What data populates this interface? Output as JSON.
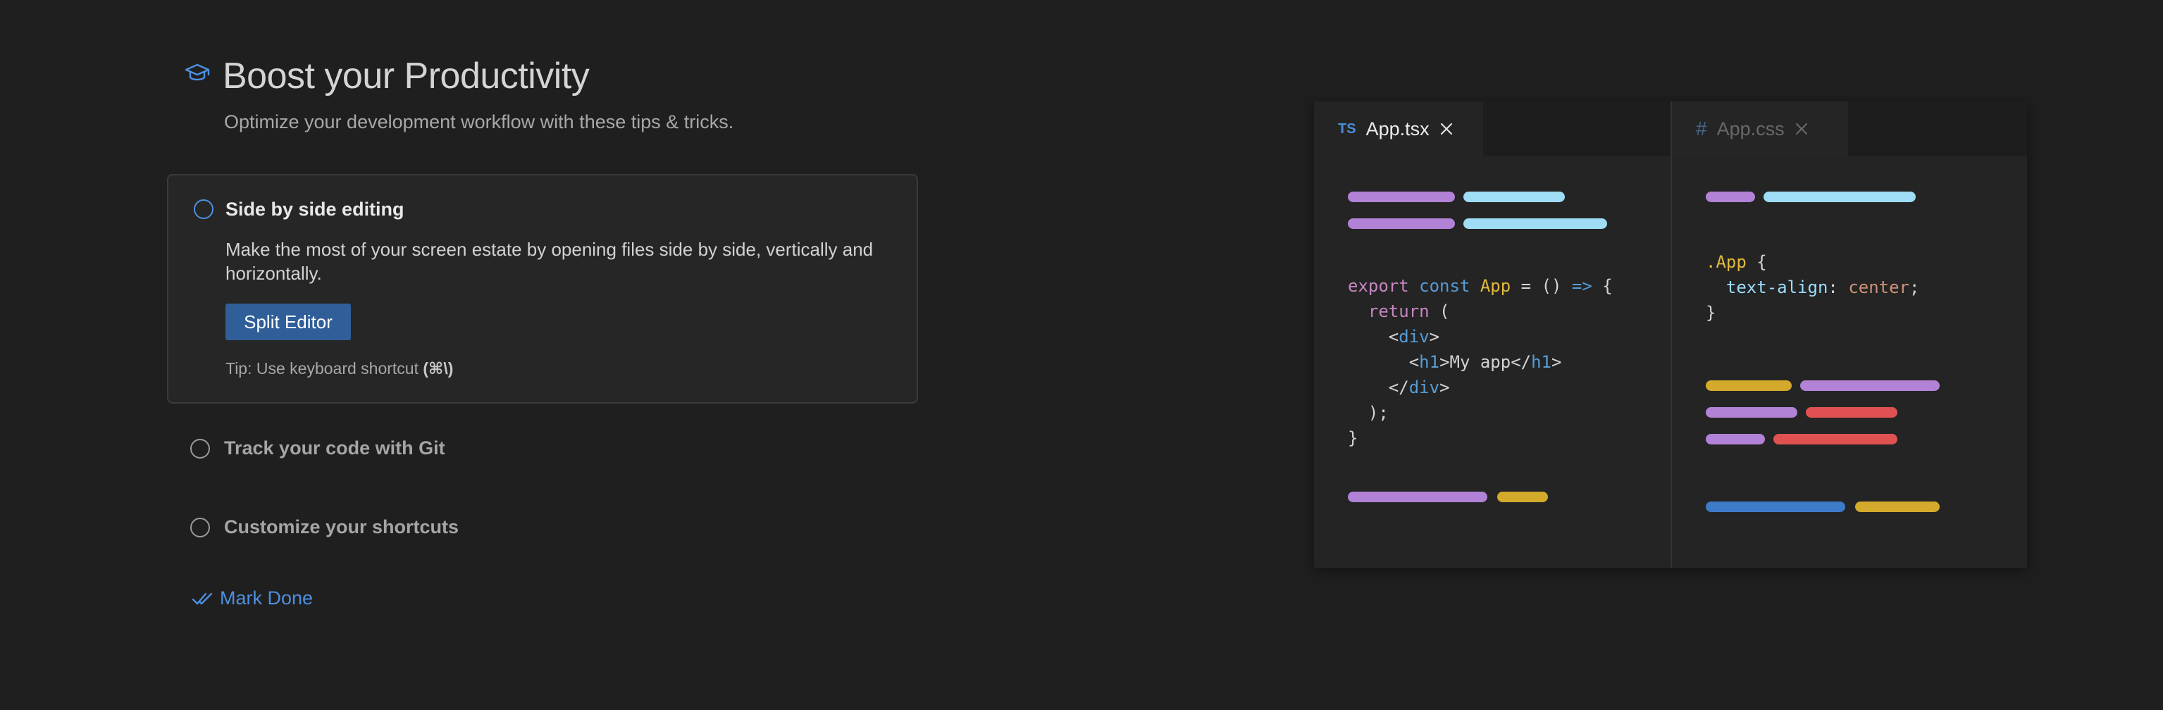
{
  "header": {
    "title": "Boost your Productivity",
    "subtitle": "Optimize your development workflow with these tips & tricks.",
    "icon": "mortarboard-icon"
  },
  "steps": [
    {
      "title": "Side by side editing",
      "expanded": true,
      "description": "Make the most of your screen estate by opening files side by side, vertically and horizontally.",
      "button_label": "Split Editor",
      "tip_prefix": "Tip: Use keyboard shortcut ",
      "tip_shortcut": "(⌘\\)"
    },
    {
      "title": "Track your code with Git",
      "expanded": false
    },
    {
      "title": "Customize your shortcuts",
      "expanded": false
    }
  ],
  "mark_done": {
    "label": "Mark Done",
    "icon": "double-check-icon"
  },
  "preview": {
    "left_tab": {
      "icon_text": "TS",
      "label": "App.tsx",
      "close_icon": "close-icon"
    },
    "right_tab": {
      "icon_text": "#",
      "label": "App.css",
      "close_icon": "close-icon"
    },
    "tsx_code": {
      "l1_export": "export",
      "l1_const": "const",
      "l1_name": "App",
      "l1_eq": " = () ",
      "l1_arrow": "=>",
      "l1_brace": " {",
      "l2_return": "return",
      "l2_paren": " (",
      "l3_open": "<",
      "l3_tag": "div",
      "l3_close": ">",
      "l4_open": "<",
      "l4_tag": "h1",
      "l4_text": ">My app</",
      "l4_tag2": "h1",
      "l4_close": ">",
      "l5_open": "</",
      "l5_tag": "div",
      "l5_close": ">",
      "l6": ");",
      "l7": "}"
    },
    "css_code": {
      "l1_selector": ".App",
      "l1_brace": " {",
      "l2_prop": "text-align",
      "l2_colon": ": ",
      "l2_value": "center",
      "l2_semi": ";",
      "l3": "}"
    },
    "colors": {
      "purple": "#b282d6",
      "cyan": "#9fdcf6",
      "yellow": "#d4aa2c",
      "red": "#e05252",
      "blue": "#3d7bc9"
    }
  }
}
